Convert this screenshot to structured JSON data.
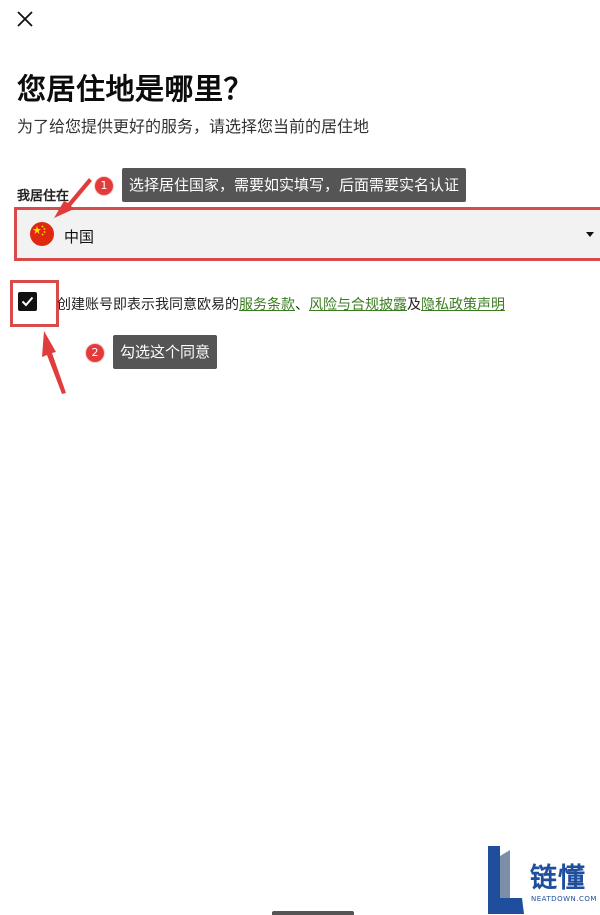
{
  "page": {
    "title": "您居住地是哪里？",
    "subtitle": "为了给您提供更好的服务，请选择您当前的居住地"
  },
  "form": {
    "residence_label": "我居住在",
    "country_value": "中国",
    "agreement_checked": true,
    "agreement_prefix": "创建账号即表示我同意欧易的",
    "terms_link": "服务条款",
    "separator": "、",
    "risk_link": "风险与合规披露",
    "and_text": "及",
    "privacy_link": "隐私政策声明"
  },
  "annotations": {
    "step1_number": "1",
    "step1_text": "选择居住国家，需要如实填写，后面需要实名认证",
    "step2_number": "2",
    "step2_text": "勾选这个同意"
  },
  "watermark": {
    "brand": "链懂",
    "domain": "NEATDOWN.COM"
  },
  "icons": {
    "close": "close-icon",
    "flag": "china-flag-icon",
    "dropdown": "caret-down-icon",
    "check": "checkmark-icon"
  },
  "colors": {
    "highlight_border": "#d94a4a",
    "link": "#3a7c20",
    "tooltip_bg": "#555555",
    "badge": "#e23b3b",
    "watermark": "#1e4e9c"
  }
}
